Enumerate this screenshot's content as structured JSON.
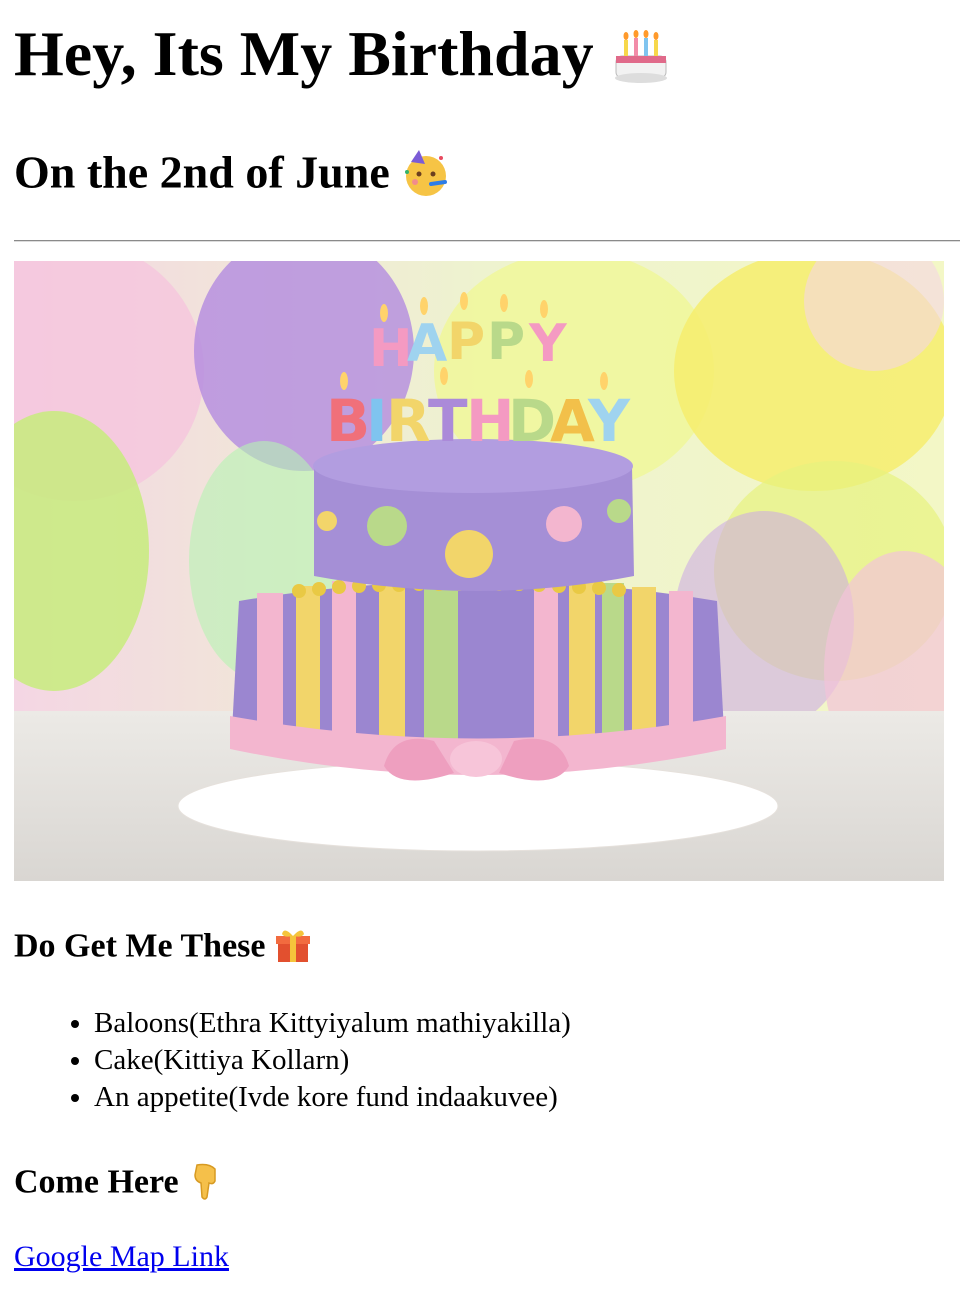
{
  "header": {
    "title": "Hey, Its My Birthday",
    "title_emoji": "🎂",
    "subtitle": "On the 2nd of June",
    "subtitle_emoji": "🥳"
  },
  "photo": {
    "icon": "birthday-cake-photo",
    "alt": "HAPPY BIRTHDAY"
  },
  "gifts": {
    "heading": "Do Get Me These",
    "heading_emoji": "🎁",
    "items": [
      "Baloons(Ethra Kittyiyalum mathiyakilla)",
      "Cake(Kittiya Kollarn)",
      "An appetite(Ivde kore fund indaakuvee)"
    ]
  },
  "location": {
    "heading": "Come Here",
    "heading_emoji": "👇",
    "link_text": "Google Map Link"
  },
  "colors": {
    "link": "#0000ee",
    "cake_purple": "#9b86d0",
    "ribbon_pink": "#f3b6cf",
    "stripe_yellow": "#f2d56a",
    "stripe_green": "#b9d98a"
  }
}
